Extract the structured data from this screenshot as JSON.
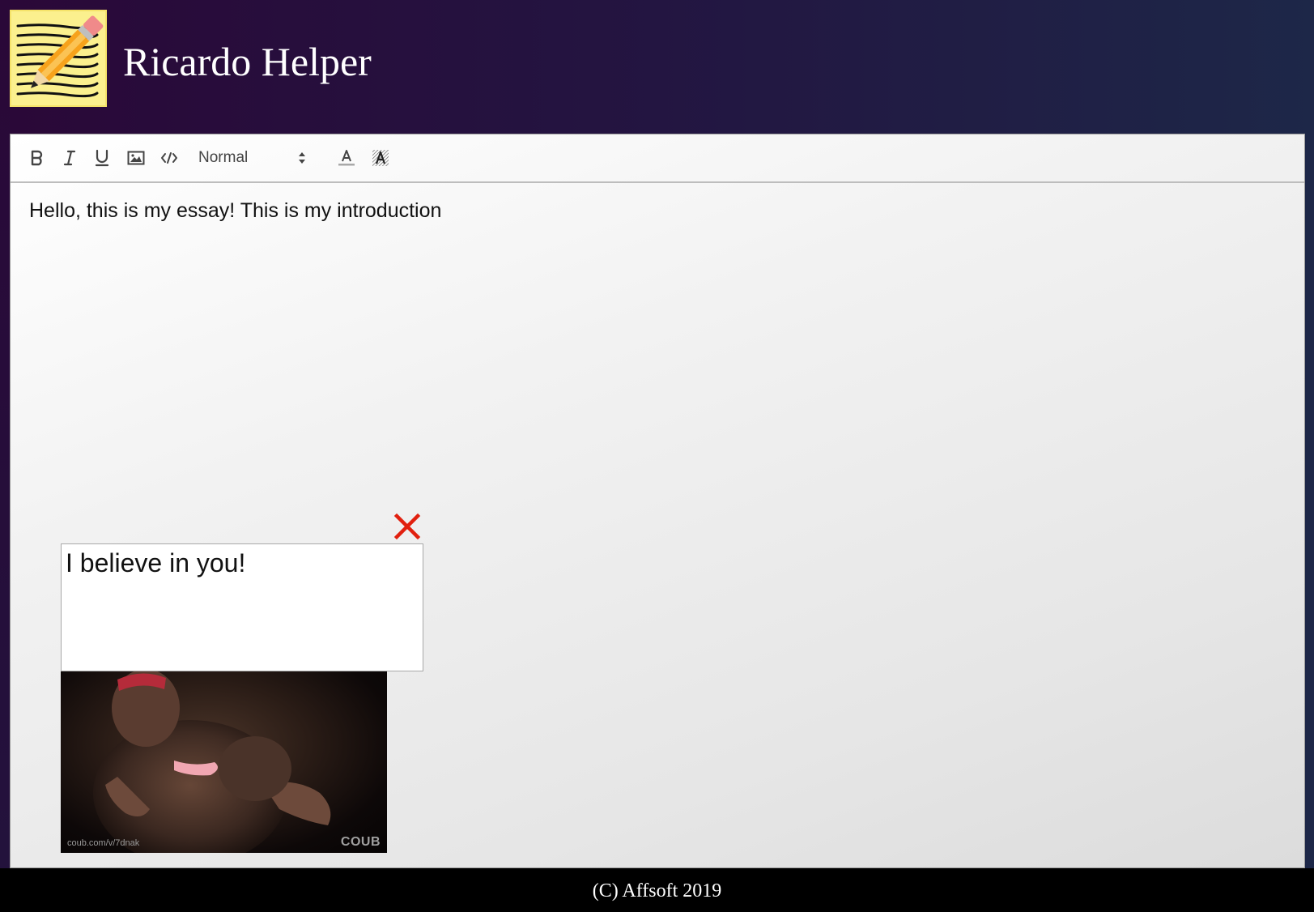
{
  "header": {
    "title": "Ricardo Helper",
    "logo_icon": "notepad-pencil-icon"
  },
  "toolbar": {
    "buttons": [
      {
        "name": "bold",
        "icon": "bold-icon"
      },
      {
        "name": "italic",
        "icon": "italic-icon"
      },
      {
        "name": "underline",
        "icon": "underline-icon"
      },
      {
        "name": "image",
        "icon": "image-icon"
      },
      {
        "name": "code",
        "icon": "code-icon"
      },
      {
        "name": "text-color",
        "icon": "text-color-icon"
      },
      {
        "name": "background-color",
        "icon": "background-color-icon"
      }
    ],
    "format_value": "Normal"
  },
  "editor": {
    "content": "Hello, this is my essay! This is my introduction"
  },
  "helper": {
    "message": "I believe in you!",
    "close_icon": "close-icon",
    "gif_source_label": "coub.com/v/7dnak",
    "gif_brand_label": "COUB"
  },
  "footer": {
    "copyright": "(C) Affsoft 2019"
  },
  "colors": {
    "header_gradient_start": "#2a0838",
    "header_gradient_end": "#1d2748",
    "close_red": "#e1200f",
    "footer_bg": "#000000"
  }
}
